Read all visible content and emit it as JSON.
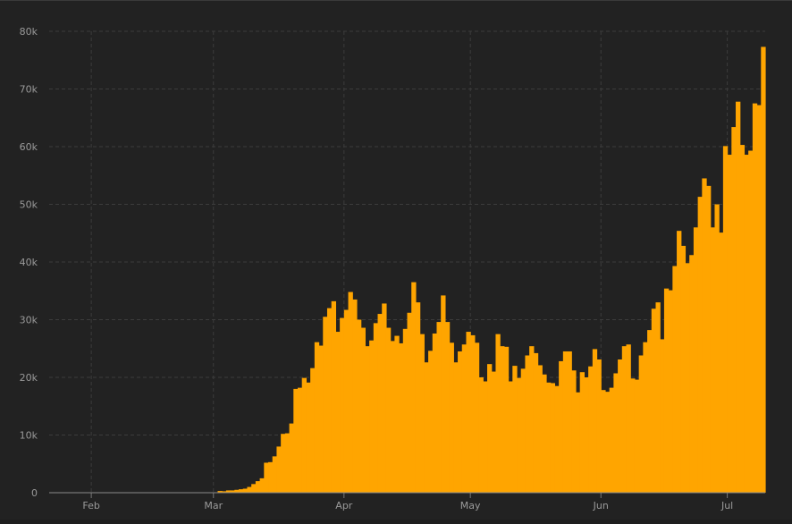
{
  "chart_data": {
    "type": "bar",
    "title": "",
    "xlabel": "",
    "ylabel": "",
    "ylim": [
      0,
      80000
    ],
    "y_ticks": [
      {
        "value": 0,
        "label": "0"
      },
      {
        "value": 10000,
        "label": "10k"
      },
      {
        "value": 20000,
        "label": "20k"
      },
      {
        "value": 30000,
        "label": "30k"
      },
      {
        "value": 40000,
        "label": "40k"
      },
      {
        "value": 50000,
        "label": "50k"
      },
      {
        "value": 60000,
        "label": "60k"
      },
      {
        "value": 70000,
        "label": "70k"
      },
      {
        "value": 80000,
        "label": "80k"
      }
    ],
    "x_start": "2020-01-22",
    "x_end": "2020-07-10",
    "x_ticks": [
      {
        "date": "2020-02-01",
        "label": "Feb"
      },
      {
        "date": "2020-03-01",
        "label": "Mar"
      },
      {
        "date": "2020-04-01",
        "label": "Apr"
      },
      {
        "date": "2020-05-01",
        "label": "May"
      },
      {
        "date": "2020-06-01",
        "label": "Jun"
      },
      {
        "date": "2020-07-01",
        "label": "Jul"
      }
    ],
    "grid": true,
    "bar_color": "#ffa500",
    "x": [
      "2020-01-22",
      "2020-01-23",
      "2020-01-24",
      "2020-01-25",
      "2020-01-26",
      "2020-01-27",
      "2020-01-28",
      "2020-01-29",
      "2020-01-30",
      "2020-01-31",
      "2020-02-01",
      "2020-02-02",
      "2020-02-03",
      "2020-02-04",
      "2020-02-05",
      "2020-02-06",
      "2020-02-07",
      "2020-02-08",
      "2020-02-09",
      "2020-02-10",
      "2020-02-11",
      "2020-02-12",
      "2020-02-13",
      "2020-02-14",
      "2020-02-15",
      "2020-02-16",
      "2020-02-17",
      "2020-02-18",
      "2020-02-19",
      "2020-02-20",
      "2020-02-21",
      "2020-02-22",
      "2020-02-23",
      "2020-02-24",
      "2020-02-25",
      "2020-02-26",
      "2020-02-27",
      "2020-02-28",
      "2020-02-29",
      "2020-03-01",
      "2020-03-02",
      "2020-03-03",
      "2020-03-04",
      "2020-03-05",
      "2020-03-06",
      "2020-03-07",
      "2020-03-08",
      "2020-03-09",
      "2020-03-10",
      "2020-03-11",
      "2020-03-12",
      "2020-03-13",
      "2020-03-14",
      "2020-03-15",
      "2020-03-16",
      "2020-03-17",
      "2020-03-18",
      "2020-03-19",
      "2020-03-20",
      "2020-03-21",
      "2020-03-22",
      "2020-03-23",
      "2020-03-24",
      "2020-03-25",
      "2020-03-26",
      "2020-03-27",
      "2020-03-28",
      "2020-03-29",
      "2020-03-30",
      "2020-03-31",
      "2020-04-01",
      "2020-04-02",
      "2020-04-03",
      "2020-04-04",
      "2020-04-05",
      "2020-04-06",
      "2020-04-07",
      "2020-04-08",
      "2020-04-09",
      "2020-04-10",
      "2020-04-11",
      "2020-04-12",
      "2020-04-13",
      "2020-04-14",
      "2020-04-15",
      "2020-04-16",
      "2020-04-17",
      "2020-04-18",
      "2020-04-19",
      "2020-04-20",
      "2020-04-21",
      "2020-04-22",
      "2020-04-23",
      "2020-04-24",
      "2020-04-25",
      "2020-04-26",
      "2020-04-27",
      "2020-04-28",
      "2020-04-29",
      "2020-04-30",
      "2020-05-01",
      "2020-05-02",
      "2020-05-03",
      "2020-05-04",
      "2020-05-05",
      "2020-05-06",
      "2020-05-07",
      "2020-05-08",
      "2020-05-09",
      "2020-05-10",
      "2020-05-11",
      "2020-05-12",
      "2020-05-13",
      "2020-05-14",
      "2020-05-15",
      "2020-05-16",
      "2020-05-17",
      "2020-05-18",
      "2020-05-19",
      "2020-05-20",
      "2020-05-21",
      "2020-05-22",
      "2020-05-23",
      "2020-05-24",
      "2020-05-25",
      "2020-05-26",
      "2020-05-27",
      "2020-05-28",
      "2020-05-29",
      "2020-05-30",
      "2020-05-31",
      "2020-06-01",
      "2020-06-02",
      "2020-06-03",
      "2020-06-04",
      "2020-06-05",
      "2020-06-06",
      "2020-06-07",
      "2020-06-08",
      "2020-06-09",
      "2020-06-10",
      "2020-06-11",
      "2020-06-12",
      "2020-06-13",
      "2020-06-14",
      "2020-06-15",
      "2020-06-16",
      "2020-06-17",
      "2020-06-18",
      "2020-06-19",
      "2020-06-20",
      "2020-06-21",
      "2020-06-22",
      "2020-06-23",
      "2020-06-24",
      "2020-06-25",
      "2020-06-26",
      "2020-06-27",
      "2020-06-28",
      "2020-06-29",
      "2020-06-30",
      "2020-07-01",
      "2020-07-02",
      "2020-07-03",
      "2020-07-04",
      "2020-07-05",
      "2020-07-06",
      "2020-07-07",
      "2020-07-08",
      "2020-07-09"
    ],
    "values": [
      0,
      0,
      1,
      0,
      1,
      0,
      0,
      0,
      2,
      1,
      1,
      0,
      3,
      0,
      0,
      0,
      0,
      0,
      0,
      0,
      1,
      0,
      1,
      0,
      0,
      0,
      0,
      0,
      0,
      0,
      2,
      0,
      0,
      0,
      5,
      10,
      8,
      20,
      20,
      20,
      300,
      250,
      400,
      400,
      500,
      600,
      700,
      1000,
      1500,
      2000,
      2500,
      5200,
      5300,
      6300,
      8000,
      10200,
      10300,
      12000,
      18000,
      18200,
      19900,
      19100,
      21600,
      26100,
      25500,
      30500,
      32000,
      33200,
      27900,
      30300,
      31700,
      34800,
      33500,
      30000,
      28600,
      25400,
      26400,
      29400,
      31000,
      32800,
      28600,
      26300,
      27200,
      25900,
      28400,
      31200,
      36500,
      33000,
      27500,
      22600,
      24600,
      27600,
      29600,
      34200,
      29600,
      26000,
      22600,
      24500,
      25700,
      27900,
      27300,
      26000,
      20000,
      19300,
      22300,
      21000,
      27500,
      25400,
      25300,
      19300,
      22000,
      19900,
      21500,
      23800,
      25400,
      24200,
      22100,
      20500,
      19100,
      19000,
      18500,
      22800,
      24500,
      24500,
      21200,
      17400,
      20900,
      20000,
      21900,
      24900,
      23100,
      17800,
      17500,
      18200,
      20700,
      23100,
      25400,
      25700,
      19800,
      19600,
      23800,
      26100,
      28200,
      31900,
      33000,
      26600,
      35400,
      35100,
      39300,
      45400,
      42800,
      39800,
      41200,
      46000,
      51300,
      54500,
      53200,
      46000,
      50000,
      45100,
      60100,
      58600,
      63400,
      67800,
      60300,
      58600,
      59300,
      67500,
      67200,
      77300
    ]
  }
}
